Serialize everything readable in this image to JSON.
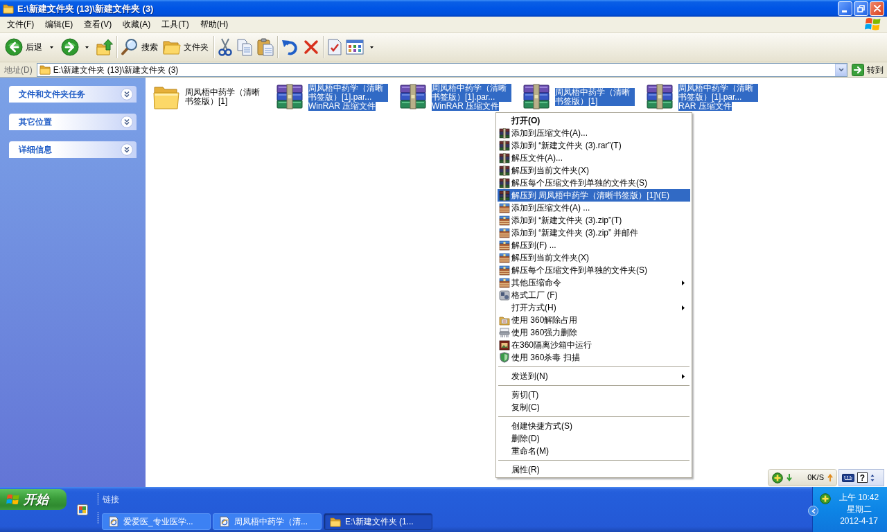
{
  "window": {
    "title": "E:\\新建文件夹 (13)\\新建文件夹 (3)"
  },
  "menu_bar": [
    "文件(F)",
    "编辑(E)",
    "查看(V)",
    "收藏(A)",
    "工具(T)",
    "帮助(H)"
  ],
  "toolbar": {
    "groups": [
      [
        {
          "kind": "back",
          "label": "后退",
          "dropdown": true
        },
        {
          "kind": "forward",
          "dropdown": true
        },
        {
          "kind": "up",
          "dropdown": false
        }
      ],
      [
        {
          "kind": "search",
          "label": "搜索",
          "dropdown": false
        },
        {
          "kind": "folders",
          "label": "文件夹",
          "dropdown": false
        }
      ],
      [
        {
          "kind": "cut",
          "dropdown": false
        },
        {
          "kind": "copy",
          "dropdown": false
        },
        {
          "kind": "paste",
          "dropdown": false
        }
      ],
      [
        {
          "kind": "undo",
          "dropdown": false
        },
        {
          "kind": "delete",
          "dropdown": false
        }
      ],
      [
        {
          "kind": "properties",
          "dropdown": false
        },
        {
          "kind": "views",
          "dropdown": true
        }
      ]
    ]
  },
  "address_bar": {
    "label": "地址(D)",
    "value": "E:\\新建文件夹 (13)\\新建文件夹 (3)",
    "go": "转到"
  },
  "sidebar": {
    "panels": [
      {
        "title": "文件和文件夹任务",
        "expanded": false
      },
      {
        "title": "其它位置",
        "expanded": false
      },
      {
        "title": "详细信息",
        "expanded": false
      }
    ]
  },
  "files": [
    {
      "kind": "folder",
      "name": "周凤梧中药学（清晰书签版）[1]",
      "selected": false
    },
    {
      "kind": "rar",
      "name": "周凤梧中药学（清晰书签版）[1].par...",
      "type": "WinRAR 压缩文件",
      "selected": true
    },
    {
      "kind": "rar",
      "name": "周凤梧中药学（清晰书签版）[1].par...",
      "type": "WinRAR 压缩文件",
      "selected": true
    },
    {
      "kind": "rar",
      "name": "周凤梧中药学（清晰书签版）[1]",
      "selected": true
    },
    {
      "kind": "rar",
      "name": "周凤梧中药学（清晰书签版）[1].par...",
      "type": "RAR 压缩文件",
      "selected": true
    }
  ],
  "context_menu": {
    "groups": [
      [
        {
          "label": "打开(O)",
          "kind": "default",
          "selected": false,
          "submenu": false
        },
        {
          "label": "添加到压缩文件(A)...",
          "kind": "rar",
          "selected": false,
          "submenu": false
        },
        {
          "label": "添加到 “新建文件夹 (3).rar”(T)",
          "kind": "rar",
          "selected": false,
          "submenu": false
        },
        {
          "label": "解压文件(A)...",
          "kind": "rar",
          "selected": false,
          "submenu": false
        },
        {
          "label": "解压到当前文件夹(X)",
          "kind": "rar",
          "selected": false,
          "submenu": false
        },
        {
          "label": "解压每个压缩文件到单独的文件夹(S)",
          "kind": "rar",
          "selected": false,
          "submenu": false
        },
        {
          "label": "解压到 周凤梧中药学（清晰书签版）[1]\\(E)",
          "kind": "rar",
          "selected": true,
          "submenu": false
        },
        {
          "label": "添加到压缩文件(A) ...",
          "kind": "zip",
          "selected": false,
          "submenu": false
        },
        {
          "label": "添加到 “新建文件夹 (3).zip”(T)",
          "kind": "zip",
          "selected": false,
          "submenu": false
        },
        {
          "label": "添加到 “新建文件夹 (3).zip” 并邮件",
          "kind": "zip",
          "selected": false,
          "submenu": false
        },
        {
          "label": "解压到(F) ...",
          "kind": "zip",
          "selected": false,
          "submenu": false
        },
        {
          "label": "解压到当前文件夹(X)",
          "kind": "zip",
          "selected": false,
          "submenu": false
        },
        {
          "label": "解压每个压缩文件到单独的文件夹(S)",
          "kind": "zip",
          "selected": false,
          "submenu": false
        },
        {
          "label": "其他压缩命令",
          "kind": "zip",
          "selected": false,
          "submenu": true
        },
        {
          "label": "格式工厂 (F)",
          "kind": "format",
          "selected": false,
          "submenu": false
        },
        {
          "label": "打开方式(H)",
          "kind": "plain",
          "selected": false,
          "submenu": true
        },
        {
          "label": "使用 360解除占用",
          "kind": "unlock",
          "selected": false,
          "submenu": false
        },
        {
          "label": "使用 360强力删除",
          "kind": "shred",
          "selected": false,
          "submenu": false
        },
        {
          "label": "在360隔离沙箱中运行",
          "kind": "sandbox",
          "selected": false,
          "submenu": false
        },
        {
          "label": "使用 360杀毒 扫描",
          "kind": "shield",
          "selected": false,
          "submenu": false
        }
      ],
      [
        {
          "label": "发送到(N)",
          "kind": "plain",
          "selected": false,
          "submenu": true
        }
      ],
      [
        {
          "label": "剪切(T)",
          "kind": "plain",
          "selected": false,
          "submenu": false
        },
        {
          "label": "复制(C)",
          "kind": "plain",
          "selected": false,
          "submenu": false
        }
      ],
      [
        {
          "label": "创建快捷方式(S)",
          "kind": "plain",
          "selected": false,
          "submenu": false
        },
        {
          "label": "删除(D)",
          "kind": "plain",
          "selected": false,
          "submenu": false
        },
        {
          "label": "重命名(M)",
          "kind": "plain",
          "selected": false,
          "submenu": false
        }
      ],
      [
        {
          "label": "属性(R)",
          "kind": "plain",
          "selected": false,
          "submenu": false
        }
      ]
    ]
  },
  "net_speed": {
    "reading": "0K/S"
  },
  "language_bar": {
    "help": "?"
  },
  "taskbar": {
    "start": "开始",
    "links_label": "链接",
    "tasks": [
      {
        "label": "爱爱医_专业医学...",
        "kind": "page",
        "selected": false
      },
      {
        "label": "周凤梧中药学（清...",
        "kind": "page",
        "selected": false
      },
      {
        "label": "E:\\新建文件夹 (1...",
        "kind": "folder",
        "selected": true
      }
    ],
    "clock": {
      "time": "上午 10:42",
      "weekday": "星期二",
      "date": "2012-4-17"
    }
  }
}
